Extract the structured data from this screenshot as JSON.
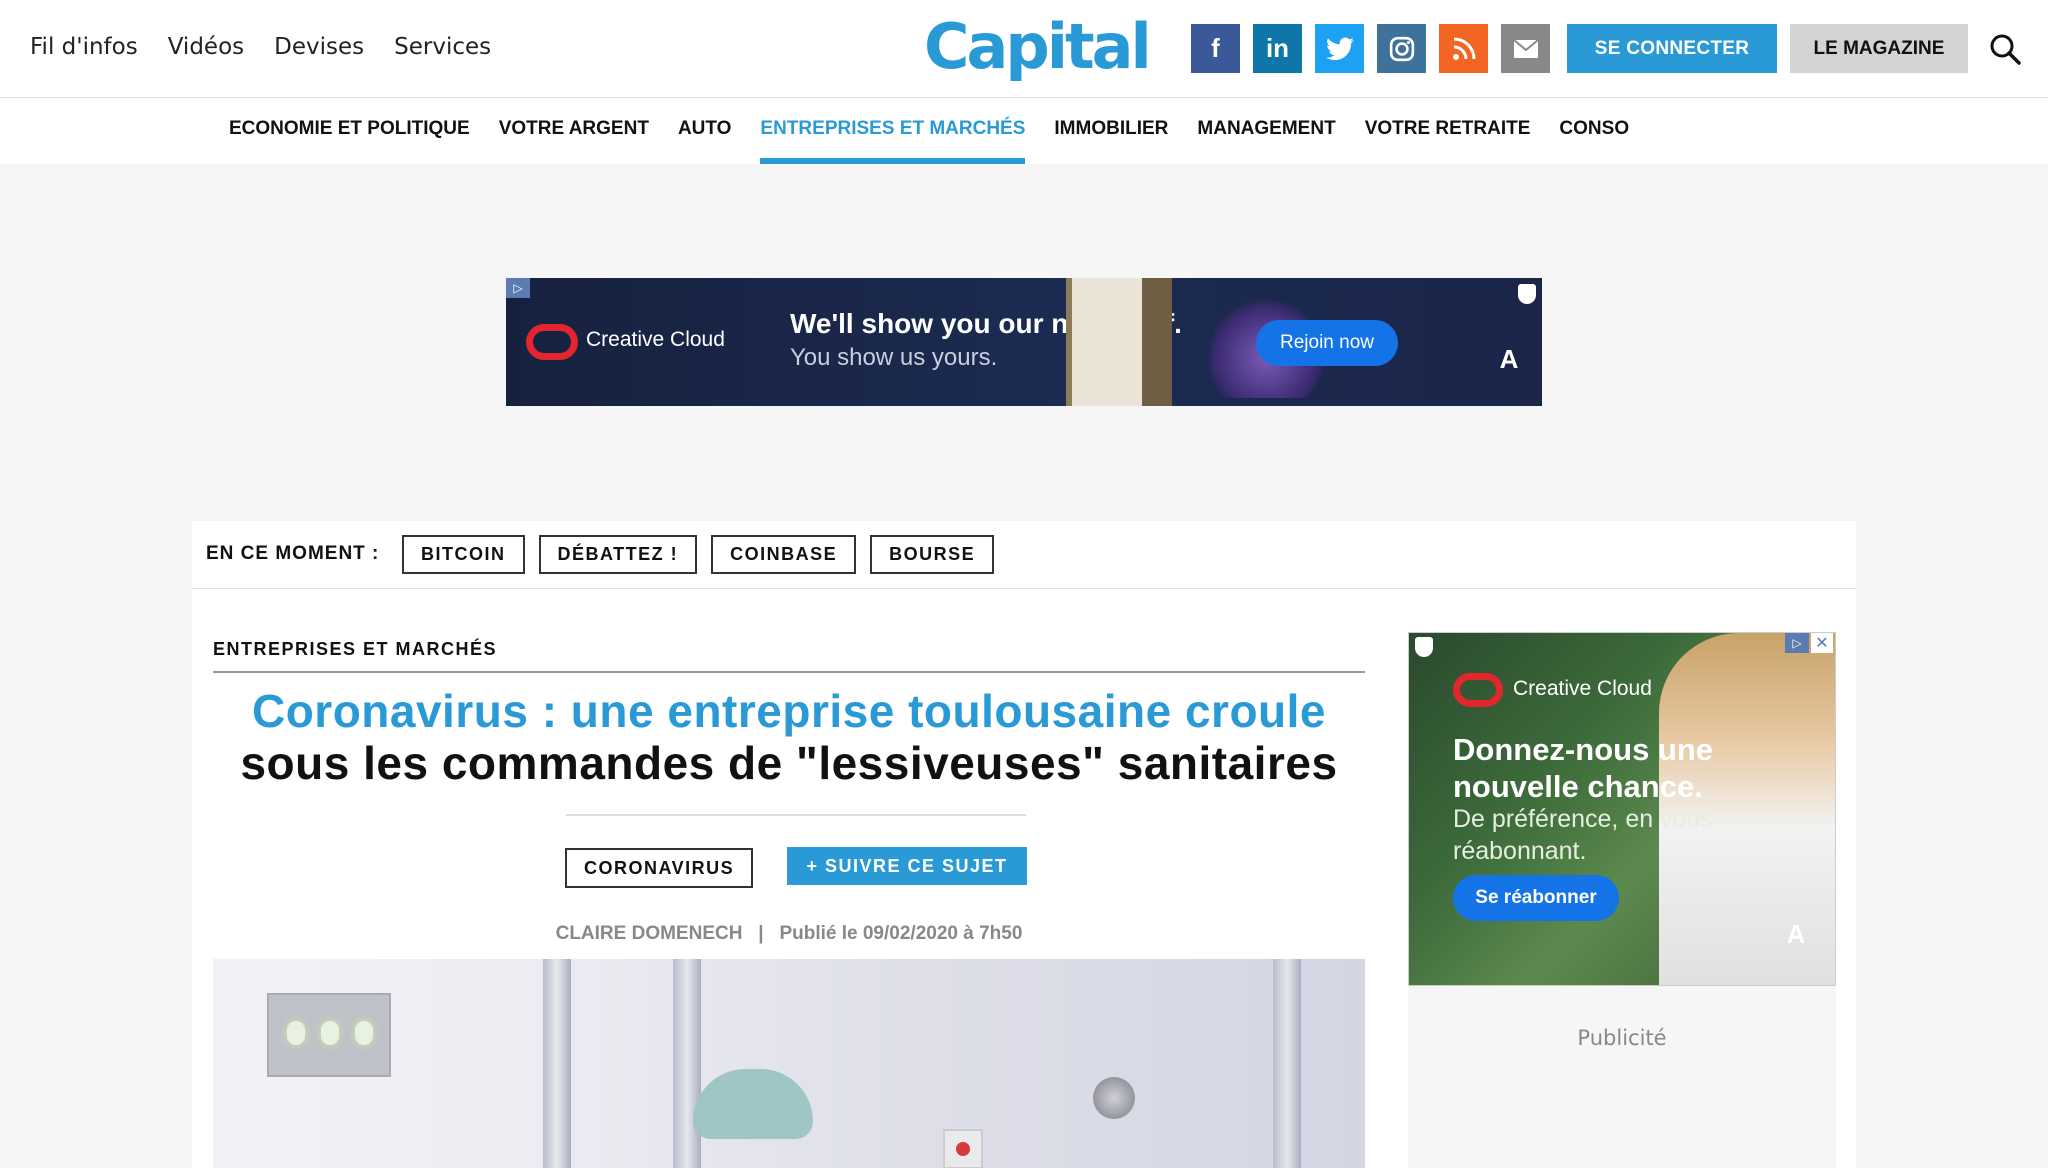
{
  "header": {
    "topnav": [
      "Fil d'infos",
      "Vidéos",
      "Devises",
      "Services"
    ],
    "logo": "Capital",
    "social_icons": [
      "facebook-icon",
      "linkedin-icon",
      "twitter-icon",
      "instagram-icon",
      "rss-icon",
      "mail-icon"
    ],
    "connect_label": "SE CONNECTER",
    "magazine_label": "LE MAGAZINE",
    "search_icon": "search-icon"
  },
  "mainnav": {
    "items": [
      "ECONOMIE ET POLITIQUE",
      "VOTRE ARGENT",
      "AUTO",
      "ENTREPRISES ET MARCHÉS",
      "IMMOBILIER",
      "MANAGEMENT",
      "VOTRE RETRAITE",
      "CONSO"
    ],
    "active": "ENTREPRISES ET MARCHÉS"
  },
  "banner_ad": {
    "brand": "Creative Cloud",
    "headline": "We'll show you our new stuff.",
    "subline": "You show us yours.",
    "cta": "Rejoin now",
    "adobe": "A"
  },
  "trending": {
    "label": "EN CE MOMENT :",
    "tags": [
      "BITCOIN",
      "DÉBATTEZ !",
      "COINBASE",
      "BOURSE"
    ]
  },
  "article": {
    "section": "ENTREPRISES ET MARCHÉS",
    "title_part1": "Coronavirus : une entreprise toulousaine croule",
    "title_part2": "sous les commandes de \"lessiveuses\" sanitaires",
    "topic_tag": "CORONAVIRUS",
    "follow_label": "+ SUIVRE CE SUJET",
    "author": "CLAIRE DOMENECH",
    "published": "Publié le 09/02/2020 à 7h50"
  },
  "side_ad": {
    "brand": "Creative Cloud",
    "headline": "Donnez-nous une nouvelle chance.",
    "subline": "De préférence, en vous réabonnant.",
    "cta": "Se réabonner",
    "adobe": "A",
    "close": "✕"
  },
  "publicite_label": "Publicité",
  "colors": {
    "accent": "#2a9ad6",
    "facebook": "#3b5998",
    "linkedin": "#0e76a8",
    "twitter": "#1da1f2",
    "instagram": "#3f729b",
    "rss": "#f26522",
    "adobe_red": "#e3262d"
  }
}
